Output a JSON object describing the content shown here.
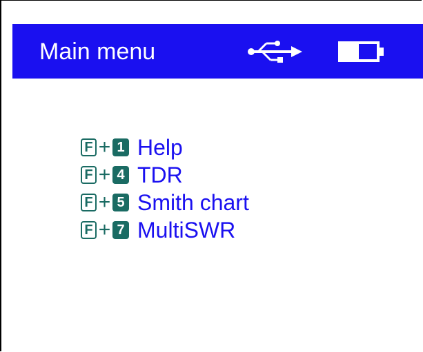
{
  "header": {
    "title": "Main menu",
    "usb_icon": "usb-icon",
    "battery_icon": "battery-icon",
    "background_color": "#1a10f0",
    "text_color": "#ffffff"
  },
  "menu": {
    "modifier_key": "F",
    "plus": "+",
    "key_color": "#1a6b63",
    "label_color": "#1a10f0",
    "items": [
      {
        "key": "1",
        "label": "Help"
      },
      {
        "key": "4",
        "label": "TDR"
      },
      {
        "key": "5",
        "label": "Smith chart"
      },
      {
        "key": "7",
        "label": "MultiSWR"
      }
    ]
  }
}
